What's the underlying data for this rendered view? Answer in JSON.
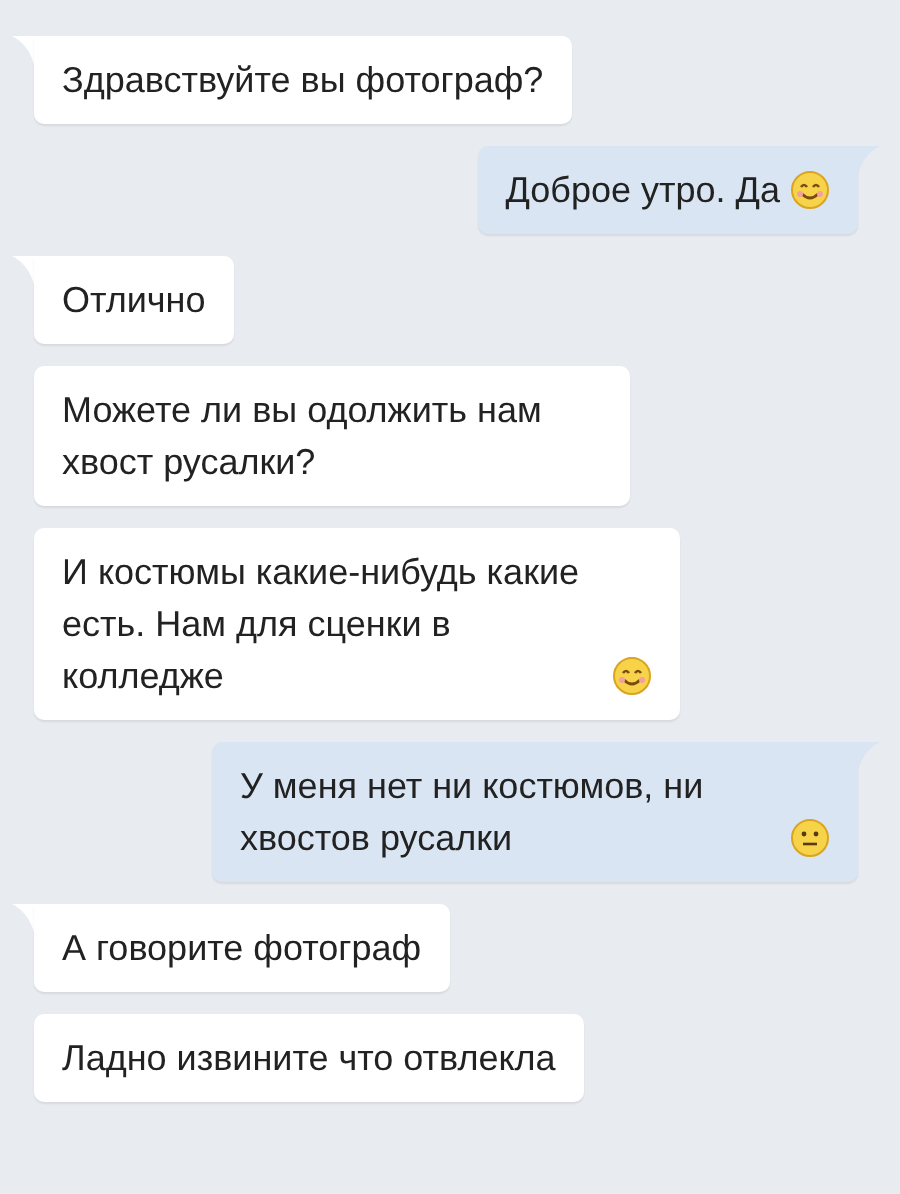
{
  "messages": [
    {
      "kind": "incoming",
      "tail": true,
      "text": "Здравствуйте вы фотограф?"
    },
    {
      "kind": "outgoing",
      "tail": true,
      "text": "Доброе утро. Да",
      "emoji": {
        "kind": "smile"
      }
    },
    {
      "kind": "incoming",
      "tail": true,
      "text": "Отлично"
    },
    {
      "kind": "incoming",
      "tail": false,
      "text": "Можете ли вы одолжить нам хвост русалки?"
    },
    {
      "kind": "incoming",
      "tail": false,
      "text": "И костюмы какие-нибудь какие есть. Нам для сценки в колледже",
      "emoji": {
        "kind": "smile"
      }
    },
    {
      "kind": "outgoing",
      "tail": true,
      "text": "У меня нет ни костюмов, ни хвостов русалки",
      "emoji": {
        "kind": "neutral"
      }
    },
    {
      "kind": "incoming",
      "tail": true,
      "text": "А говорите фотограф"
    },
    {
      "kind": "incoming",
      "tail": false,
      "text": "Ладно извините что отвлекла"
    }
  ]
}
